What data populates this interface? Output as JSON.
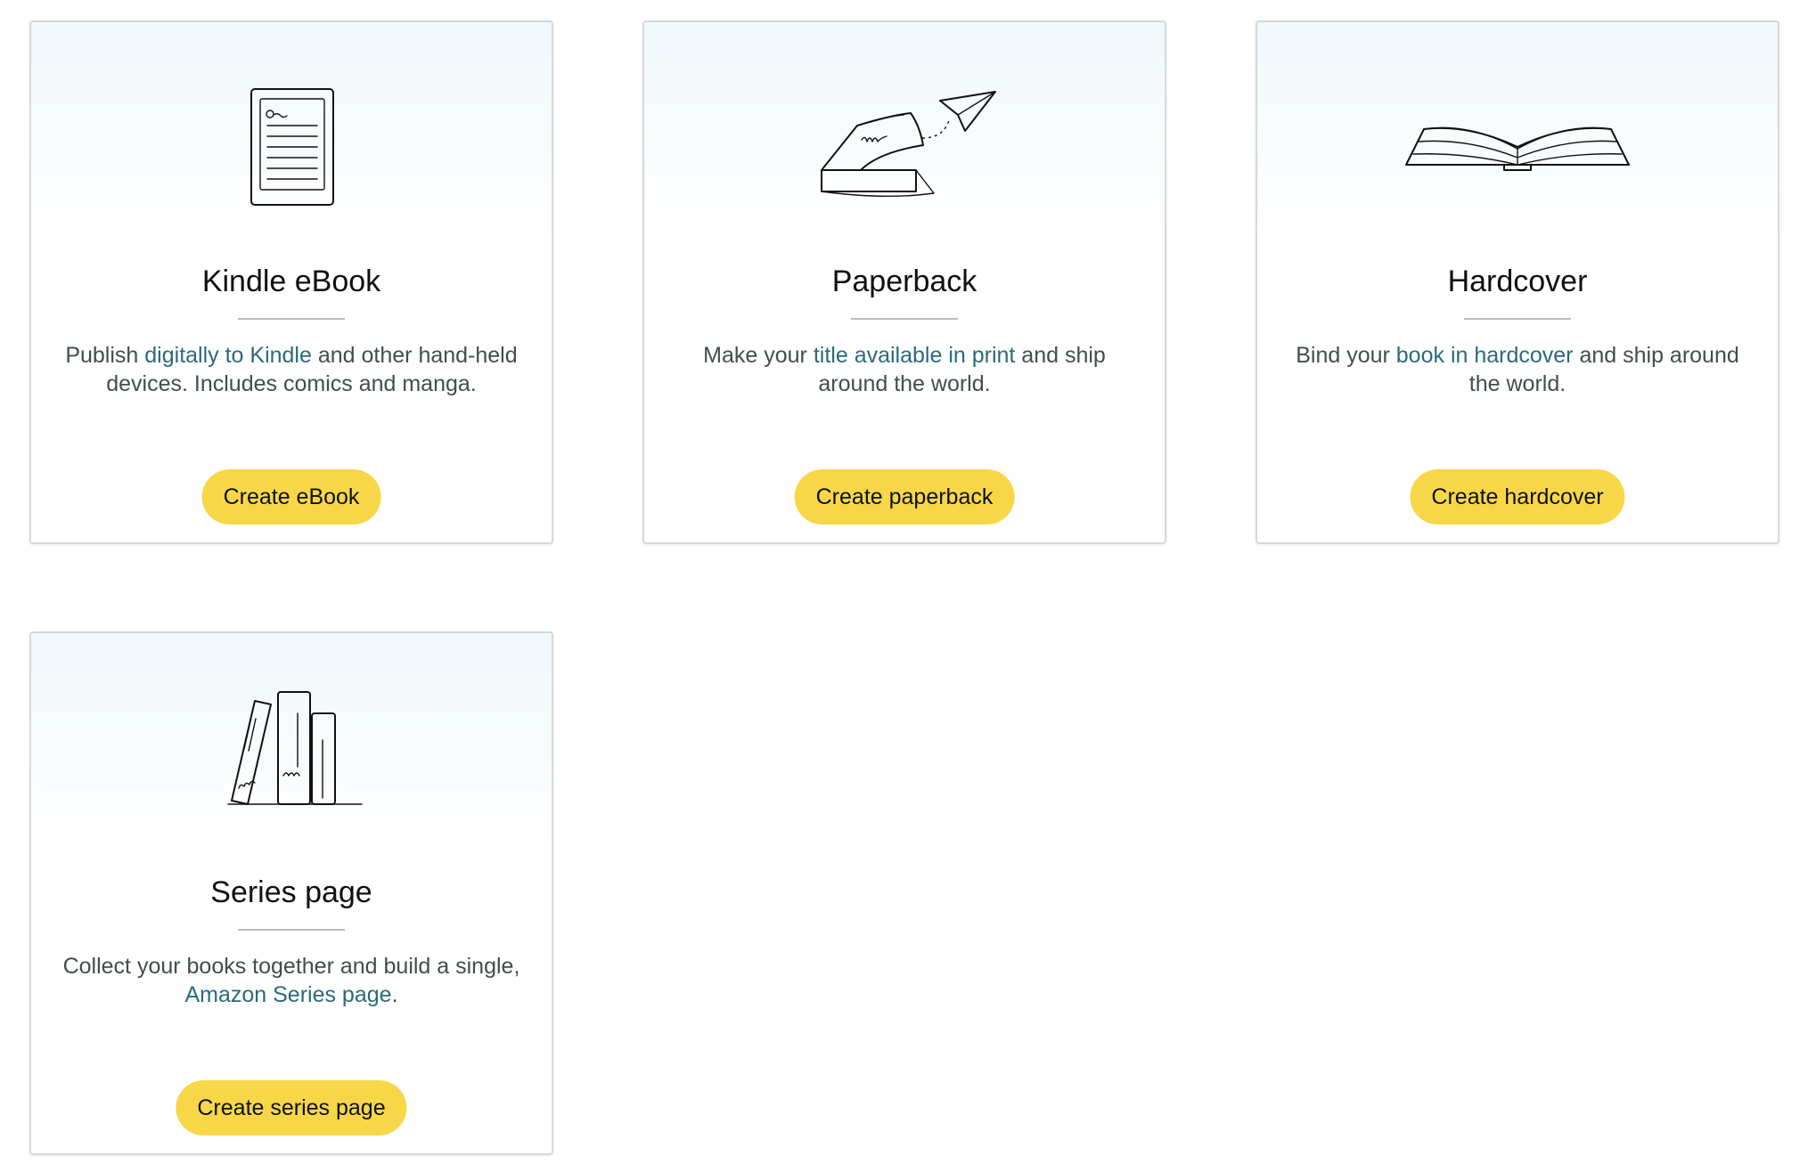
{
  "cards": [
    {
      "id": "ebook",
      "icon": "ereader-icon",
      "title": "Kindle eBook",
      "desc_before": "Publish ",
      "desc_link": "digitally to Kindle",
      "desc_after": " and other hand-held devices. Includes comics and manga.",
      "button": "Create eBook"
    },
    {
      "id": "paperback",
      "icon": "paperback-plane-icon",
      "title": "Paperback",
      "desc_before": "Make your ",
      "desc_link": "title available in print",
      "desc_after": " and ship around the world.",
      "button": "Create paperback"
    },
    {
      "id": "hardcover",
      "icon": "open-book-icon",
      "title": "Hardcover",
      "desc_before": "Bind your ",
      "desc_link": "book in hardcover",
      "desc_after": " and ship around the world.",
      "button": "Create hardcover"
    },
    {
      "id": "series",
      "icon": "books-series-icon",
      "title": "Series page",
      "desc_before": "Collect your books together and build a single, ",
      "desc_link": "Amazon Series page",
      "desc_after": ".",
      "button": "Create series page"
    }
  ],
  "colors": {
    "button": "#f7d748",
    "link": "#2b6a7c",
    "card_border": "#d5d9d9",
    "card_gradient_top": "#f0f8fb"
  }
}
